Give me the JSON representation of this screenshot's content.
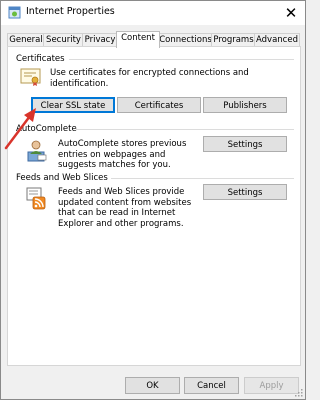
{
  "window": {
    "title": "Internet Properties"
  },
  "tabs": [
    {
      "label": "General",
      "active": false
    },
    {
      "label": "Security",
      "active": false
    },
    {
      "label": "Privacy",
      "active": false
    },
    {
      "label": "Content",
      "active": true
    },
    {
      "label": "Connections",
      "active": false
    },
    {
      "label": "Programs",
      "active": false
    },
    {
      "label": "Advanced",
      "active": false
    }
  ],
  "certificates": {
    "label": "Certificates",
    "description": "Use certificates for encrypted connections and identification.",
    "buttons": {
      "clear_ssl": "Clear SSL state",
      "certificates": "Certificates",
      "publishers": "Publishers"
    }
  },
  "autocomplete": {
    "label": "AutoComplete",
    "description": "AutoComplete stores previous entries on webpages and suggests matches for you.",
    "settings": "Settings"
  },
  "feeds": {
    "label": "Feeds and Web Slices",
    "description": "Feeds and Web Slices provide updated content from websites that can be read in Internet Explorer and other programs.",
    "settings": "Settings"
  },
  "footer": {
    "ok": "OK",
    "cancel": "Cancel",
    "apply": "Apply"
  },
  "colors": {
    "focus": "#0078d7",
    "arrow": "#d9342b"
  },
  "icons": [
    "internet-options-icon",
    "close-icon",
    "certificate-icon",
    "autocomplete-icon",
    "rss-feed-icon",
    "resize-grip-icon",
    "annotation-arrow"
  ]
}
